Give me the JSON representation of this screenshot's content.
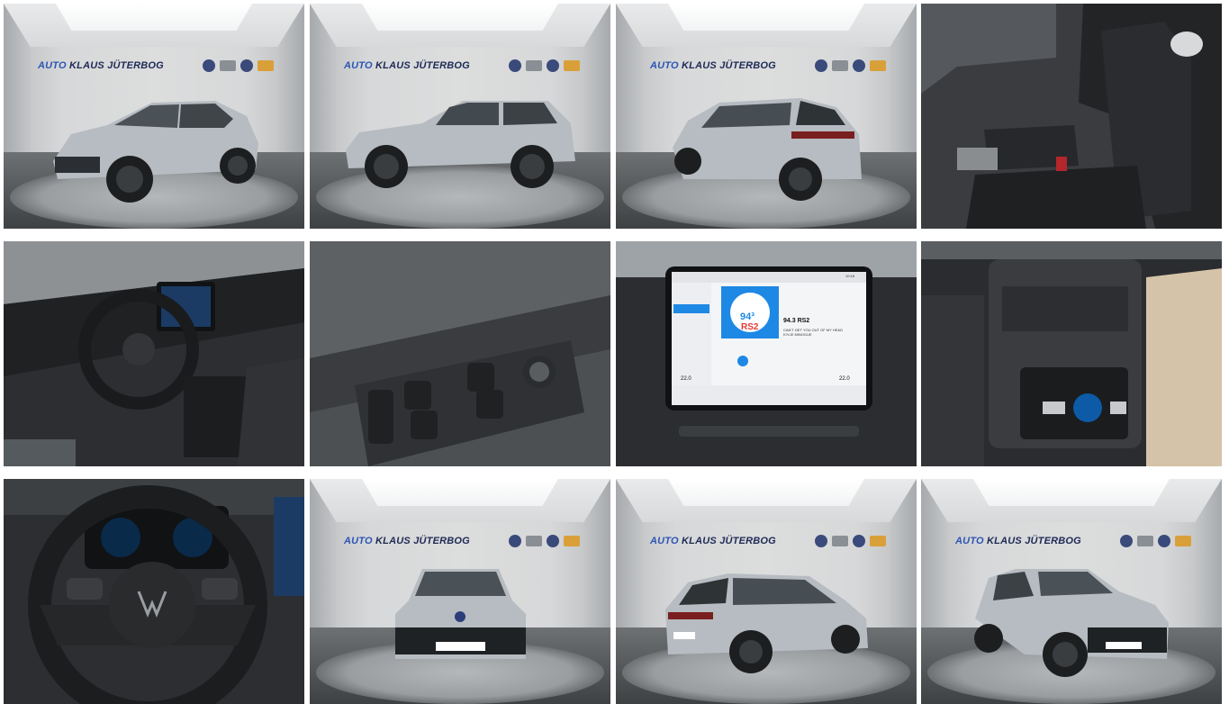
{
  "gallery": {
    "dealer_sign": {
      "part1": "AUTO",
      "part2": "KLAUS",
      "part3": "JÜTERBOG"
    },
    "screen": {
      "station_number": "94³",
      "station_logo": "RS2",
      "station_name": "94.3 RS2",
      "track": "CAN'T GET YOU OUT OF MY HEAD",
      "artist": "KYLIE MINOGUE",
      "temp_left": "22.0",
      "temp_right": "22.0",
      "status_time": "10:18"
    },
    "colors": {
      "car_body": "#b6bcc1",
      "interior_dark": "#2a2c2f",
      "screen_accent": "#1e88e5"
    }
  }
}
